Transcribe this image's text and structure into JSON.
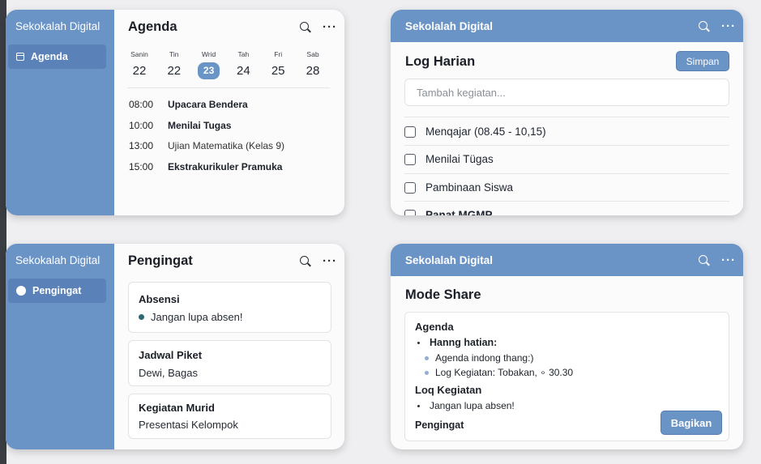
{
  "app_name": "Sekokalah Digital",
  "app_name_alt": "Sekolalah Digital",
  "colors": {
    "accent": "#6a93c6",
    "accent_dark": "#5a82b8",
    "background": "#efeff1"
  },
  "icons": {
    "search": "search-icon",
    "more": "more-icon",
    "agenda_nav": "calendar-icon",
    "reminder_nav": "dot-icon"
  },
  "agenda_card": {
    "sidebar_item": "Agenda",
    "title": "Agenda",
    "more_label": "···",
    "days": [
      {
        "name": "Sanin",
        "num": "22"
      },
      {
        "name": "Tin",
        "num": "22"
      },
      {
        "name": "Wrid",
        "num": "23",
        "selected": true
      },
      {
        "name": "Tah",
        "num": "24"
      },
      {
        "name": "Fri",
        "num": "25"
      },
      {
        "name": "Sab",
        "num": "28"
      }
    ],
    "events": [
      {
        "time": "08:00",
        "name": "Upacara Bendera"
      },
      {
        "time": "10:00",
        "name": "Menilai Tugas"
      },
      {
        "time": "13:00",
        "name": "Ujian Matematika (Kelas 9)"
      },
      {
        "time": "15:00",
        "name": "Ekstrakurikuler Pramuka"
      }
    ]
  },
  "log_card": {
    "title": "Log Harian",
    "save_label": "Simpan",
    "more_label": "···",
    "input_placeholder": "Tambah kegiatan...",
    "tasks": [
      {
        "label": "Menqajar (08.45 - 10,15)"
      },
      {
        "label": "Menilai Tügas"
      },
      {
        "label": "Pambinaan Siswa"
      },
      {
        "label": "Panat MGMP"
      }
    ]
  },
  "reminder_card": {
    "sidebar_item": "Pengingat",
    "title": "Pengingat",
    "more_label": "···",
    "items": [
      {
        "title": "Absensi",
        "body": "Jangan lupa absen!"
      },
      {
        "title": "Jadwal Piket",
        "body": "Dewi, Bagas"
      },
      {
        "title": "Kegiatan Murid",
        "body": "Presentasi Kelompok"
      }
    ]
  },
  "share_card": {
    "title": "Mode Share",
    "more_label": "···",
    "share_label": "Bagikan",
    "section_agenda": "Agenda",
    "agenda_bullet": "Hanng hatian:",
    "agenda_sub": [
      "Agenda indong thang:)",
      "Log Kegiatan: Tobakan, ∘ 30.30"
    ],
    "section_log": "Loq Kegiatan",
    "log_bullet": "Jangan lupa absen!",
    "section_reminder": "Pengingat"
  }
}
